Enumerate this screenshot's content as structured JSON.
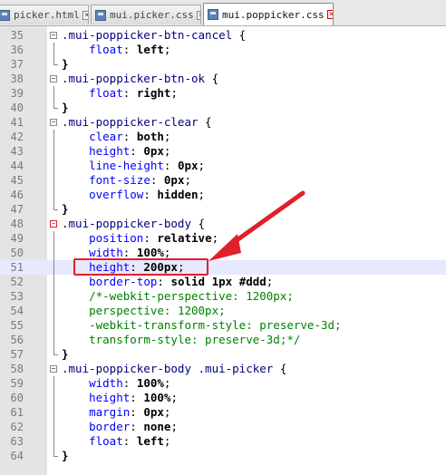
{
  "tabs": [
    {
      "label": "picker.html",
      "active": false
    },
    {
      "label": "mui.picker.css",
      "active": false
    },
    {
      "label": "mui.poppicker.css",
      "active": true
    }
  ],
  "lines": [
    {
      "num": "35",
      "tokens": [
        {
          "t": "sel",
          "v": ".mui-poppicker-btn-cancel"
        },
        {
          "t": "plain",
          "v": " {"
        }
      ],
      "fold": "start"
    },
    {
      "num": "36",
      "tokens": [
        {
          "t": "plain",
          "v": "    "
        },
        {
          "t": "prop",
          "v": "float"
        },
        {
          "t": "plain",
          "v": ": "
        },
        {
          "t": "val",
          "v": "left"
        },
        {
          "t": "plain",
          "v": ";"
        }
      ]
    },
    {
      "num": "37",
      "tokens": [
        {
          "t": "brace",
          "v": "}"
        }
      ],
      "fold": "end"
    },
    {
      "num": "38",
      "tokens": [
        {
          "t": "sel",
          "v": ".mui-poppicker-btn-ok"
        },
        {
          "t": "plain",
          "v": " {"
        }
      ],
      "fold": "start"
    },
    {
      "num": "39",
      "tokens": [
        {
          "t": "plain",
          "v": "    "
        },
        {
          "t": "prop",
          "v": "float"
        },
        {
          "t": "plain",
          "v": ": "
        },
        {
          "t": "val",
          "v": "right"
        },
        {
          "t": "plain",
          "v": ";"
        }
      ]
    },
    {
      "num": "40",
      "tokens": [
        {
          "t": "brace",
          "v": "}"
        }
      ],
      "fold": "end"
    },
    {
      "num": "41",
      "tokens": [
        {
          "t": "sel",
          "v": ".mui-poppicker-clear"
        },
        {
          "t": "plain",
          "v": " {"
        }
      ],
      "fold": "start"
    },
    {
      "num": "42",
      "tokens": [
        {
          "t": "plain",
          "v": "    "
        },
        {
          "t": "prop",
          "v": "clear"
        },
        {
          "t": "plain",
          "v": ": "
        },
        {
          "t": "val",
          "v": "both"
        },
        {
          "t": "plain",
          "v": ";"
        }
      ]
    },
    {
      "num": "43",
      "tokens": [
        {
          "t": "plain",
          "v": "    "
        },
        {
          "t": "prop",
          "v": "height"
        },
        {
          "t": "plain",
          "v": ": "
        },
        {
          "t": "val",
          "v": "0px"
        },
        {
          "t": "plain",
          "v": ";"
        }
      ]
    },
    {
      "num": "44",
      "tokens": [
        {
          "t": "plain",
          "v": "    "
        },
        {
          "t": "prop",
          "v": "line-height"
        },
        {
          "t": "plain",
          "v": ": "
        },
        {
          "t": "val",
          "v": "0px"
        },
        {
          "t": "plain",
          "v": ";"
        }
      ]
    },
    {
      "num": "45",
      "tokens": [
        {
          "t": "plain",
          "v": "    "
        },
        {
          "t": "prop",
          "v": "font-size"
        },
        {
          "t": "plain",
          "v": ": "
        },
        {
          "t": "val",
          "v": "0px"
        },
        {
          "t": "plain",
          "v": ";"
        }
      ]
    },
    {
      "num": "46",
      "tokens": [
        {
          "t": "plain",
          "v": "    "
        },
        {
          "t": "prop",
          "v": "overflow"
        },
        {
          "t": "plain",
          "v": ": "
        },
        {
          "t": "val",
          "v": "hidden"
        },
        {
          "t": "plain",
          "v": ";"
        }
      ]
    },
    {
      "num": "47",
      "tokens": [
        {
          "t": "brace",
          "v": "}"
        }
      ],
      "fold": "end"
    },
    {
      "num": "48",
      "tokens": [
        {
          "t": "sel",
          "v": ".mui-poppicker-body"
        },
        {
          "t": "plain",
          "v": " {"
        }
      ],
      "fold": "start",
      "redfold": true
    },
    {
      "num": "49",
      "tokens": [
        {
          "t": "plain",
          "v": "    "
        },
        {
          "t": "prop",
          "v": "position"
        },
        {
          "t": "plain",
          "v": ": "
        },
        {
          "t": "val",
          "v": "relative"
        },
        {
          "t": "plain",
          "v": ";"
        }
      ]
    },
    {
      "num": "50",
      "tokens": [
        {
          "t": "plain",
          "v": "    "
        },
        {
          "t": "prop",
          "v": "width"
        },
        {
          "t": "plain",
          "v": ": "
        },
        {
          "t": "val",
          "v": "100%"
        },
        {
          "t": "plain",
          "v": ";"
        }
      ]
    },
    {
      "num": "51",
      "tokens": [
        {
          "t": "plain",
          "v": "    "
        },
        {
          "t": "prop",
          "v": "height"
        },
        {
          "t": "plain",
          "v": ": "
        },
        {
          "t": "val",
          "v": "200px"
        },
        {
          "t": "plain",
          "v": ";"
        }
      ],
      "highlight": true
    },
    {
      "num": "52",
      "tokens": [
        {
          "t": "plain",
          "v": "    "
        },
        {
          "t": "prop",
          "v": "border-top"
        },
        {
          "t": "plain",
          "v": ": "
        },
        {
          "t": "val",
          "v": "solid 1px #ddd"
        },
        {
          "t": "plain",
          "v": ";"
        }
      ]
    },
    {
      "num": "53",
      "tokens": [
        {
          "t": "plain",
          "v": "    "
        },
        {
          "t": "comment",
          "v": "/*-webkit-perspective: 1200px;"
        }
      ]
    },
    {
      "num": "54",
      "tokens": [
        {
          "t": "plain",
          "v": "    "
        },
        {
          "t": "comment",
          "v": "perspective: 1200px;"
        }
      ]
    },
    {
      "num": "55",
      "tokens": [
        {
          "t": "plain",
          "v": "    "
        },
        {
          "t": "comment",
          "v": "-webkit-transform-style: preserve-3d;"
        }
      ]
    },
    {
      "num": "56",
      "tokens": [
        {
          "t": "plain",
          "v": "    "
        },
        {
          "t": "comment",
          "v": "transform-style: preserve-3d;*/"
        }
      ]
    },
    {
      "num": "57",
      "tokens": [
        {
          "t": "brace",
          "v": "}"
        }
      ],
      "fold": "end"
    },
    {
      "num": "58",
      "tokens": [
        {
          "t": "sel",
          "v": ".mui-poppicker-body .mui-picker"
        },
        {
          "t": "plain",
          "v": " {"
        }
      ],
      "fold": "start"
    },
    {
      "num": "59",
      "tokens": [
        {
          "t": "plain",
          "v": "    "
        },
        {
          "t": "prop",
          "v": "width"
        },
        {
          "t": "plain",
          "v": ": "
        },
        {
          "t": "val",
          "v": "100%"
        },
        {
          "t": "plain",
          "v": ";"
        }
      ]
    },
    {
      "num": "60",
      "tokens": [
        {
          "t": "plain",
          "v": "    "
        },
        {
          "t": "prop",
          "v": "height"
        },
        {
          "t": "plain",
          "v": ": "
        },
        {
          "t": "val",
          "v": "100%"
        },
        {
          "t": "plain",
          "v": ";"
        }
      ]
    },
    {
      "num": "61",
      "tokens": [
        {
          "t": "plain",
          "v": "    "
        },
        {
          "t": "prop",
          "v": "margin"
        },
        {
          "t": "plain",
          "v": ": "
        },
        {
          "t": "val",
          "v": "0px"
        },
        {
          "t": "plain",
          "v": ";"
        }
      ]
    },
    {
      "num": "62",
      "tokens": [
        {
          "t": "plain",
          "v": "    "
        },
        {
          "t": "prop",
          "v": "border"
        },
        {
          "t": "plain",
          "v": ": "
        },
        {
          "t": "val",
          "v": "none"
        },
        {
          "t": "plain",
          "v": ";"
        }
      ]
    },
    {
      "num": "63",
      "tokens": [
        {
          "t": "plain",
          "v": "    "
        },
        {
          "t": "prop",
          "v": "float"
        },
        {
          "t": "plain",
          "v": ": "
        },
        {
          "t": "val",
          "v": "left"
        },
        {
          "t": "plain",
          "v": ";"
        }
      ]
    },
    {
      "num": "64",
      "tokens": [
        {
          "t": "brace",
          "v": "}"
        }
      ],
      "fold": "end"
    }
  ],
  "colors": {
    "annotation": "#e0202a",
    "selector": "#000080",
    "property": "#0000ff",
    "comment": "#008000"
  }
}
